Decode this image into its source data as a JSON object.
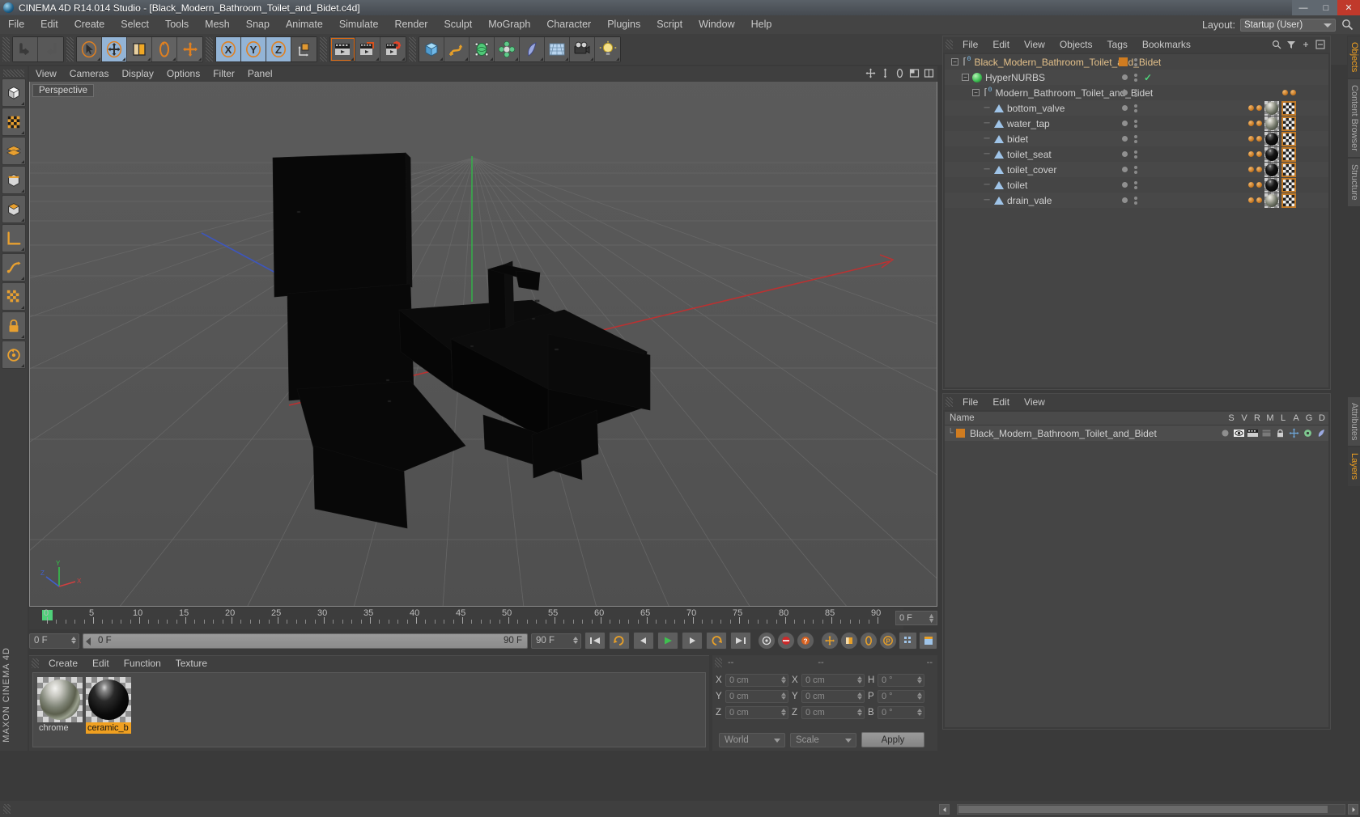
{
  "window": {
    "title": "CINEMA 4D R14.014 Studio - [Black_Modern_Bathroom_Toilet_and_Bidet.c4d]",
    "minimize": "—",
    "maximize": "□",
    "close": "✕"
  },
  "menubar": {
    "items": [
      "File",
      "Edit",
      "Create",
      "Select",
      "Tools",
      "Mesh",
      "Snap",
      "Animate",
      "Simulate",
      "Render",
      "Sculpt",
      "MoGraph",
      "Character",
      "Plugins",
      "Script",
      "Window",
      "Help"
    ],
    "layout_label": "Layout:",
    "layout_value": "Startup (User)",
    "search_icon": "magnifier-icon"
  },
  "toolbar": {
    "groups": [
      {
        "name": "history",
        "buttons": [
          {
            "name": "undo-button",
            "icon": "undo-arrow-icon",
            "state": "normal"
          },
          {
            "name": "redo-button",
            "icon": "redo-arrow-icon",
            "state": "disabled"
          }
        ]
      },
      {
        "name": "transform",
        "buttons": [
          {
            "name": "live-selection-button",
            "icon": "cursor-icon",
            "state": "normal"
          },
          {
            "name": "move-tool-button",
            "icon": "move-cross-icon",
            "state": "active"
          },
          {
            "name": "scale-tool-button",
            "icon": "scale-box-icon",
            "state": "normal"
          },
          {
            "name": "rotate-tool-button",
            "icon": "rotate-circle-icon",
            "state": "normal"
          },
          {
            "name": "combined-tool-button",
            "icon": "plus-cross-icon",
            "state": "normal"
          }
        ]
      },
      {
        "name": "axis-locks",
        "buttons": [
          {
            "name": "lock-x-axis-button",
            "icon": "x-axis-icon",
            "state": "active"
          },
          {
            "name": "lock-y-axis-button",
            "icon": "y-axis-icon",
            "state": "active"
          },
          {
            "name": "lock-z-axis-button",
            "icon": "z-axis-icon",
            "state": "active"
          },
          {
            "name": "world-object-coord-button",
            "icon": "world-cube-icon",
            "state": "normal"
          }
        ]
      },
      {
        "name": "render",
        "buttons": [
          {
            "name": "render-view-button",
            "icon": "render-clapper-icon",
            "state": "selected"
          },
          {
            "name": "render-to-picture-viewer-button",
            "icon": "render-picture-icon",
            "state": "normal"
          },
          {
            "name": "render-settings-button",
            "icon": "render-gear-icon",
            "state": "normal"
          }
        ]
      },
      {
        "name": "objects",
        "buttons": [
          {
            "name": "add-cube-button",
            "icon": "cube-icon",
            "state": "normal"
          },
          {
            "name": "add-spline-button",
            "icon": "spline-icon",
            "state": "normal"
          },
          {
            "name": "add-nurbs-button",
            "icon": "nurbs-icon",
            "state": "normal"
          },
          {
            "name": "add-array-button",
            "icon": "array-icon",
            "state": "normal"
          },
          {
            "name": "add-deformer-button",
            "icon": "bend-deformer-icon",
            "state": "normal"
          },
          {
            "name": "add-environment-button",
            "icon": "floor-environment-icon",
            "state": "normal"
          },
          {
            "name": "add-camera-button",
            "icon": "camera-icon",
            "state": "normal"
          },
          {
            "name": "add-light-button",
            "icon": "light-bulb-icon",
            "state": "normal"
          }
        ]
      }
    ]
  },
  "left_palette": {
    "buttons": [
      {
        "name": "model-mode-button",
        "icon": "model-cube-icon"
      },
      {
        "name": "texture-mode-button",
        "icon": "texture-checker-icon"
      },
      {
        "name": "point-mode-button",
        "icon": "points-icon"
      },
      {
        "name": "edge-mode-button",
        "icon": "edge-icon"
      },
      {
        "name": "polygon-mode-button",
        "icon": "polygon-icon"
      },
      {
        "name": "workplane-button",
        "icon": "workplane-icon"
      },
      {
        "name": "enable-axis-button",
        "icon": "axis-modify-icon"
      },
      {
        "name": "viewport-solo-button",
        "icon": "viewport-solo-icon"
      },
      {
        "name": "lock-workplane-button",
        "icon": "lock-icon"
      },
      {
        "name": "planar-workplane-button",
        "icon": "planar-rotate-icon"
      }
    ],
    "branding": "MAXON CINEMA 4D"
  },
  "viewport": {
    "menu": [
      "View",
      "Cameras",
      "Display",
      "Options",
      "Filter",
      "Panel"
    ],
    "label": "Perspective",
    "corner_icons": [
      "pan-icon",
      "dolly-icon",
      "rotate-icon",
      "maximize-icon",
      "layout-icon"
    ],
    "axis_gizmo": {
      "x": "X",
      "y": "Y",
      "z": "Z"
    },
    "axis_colors": {
      "x": "#d04040",
      "y": "#40c040",
      "z": "#4060d0"
    }
  },
  "timeline": {
    "ruler_labels": [
      "0",
      "5",
      "10",
      "15",
      "20",
      "25",
      "30",
      "35",
      "40",
      "45",
      "50",
      "55",
      "60",
      "65",
      "70",
      "75",
      "80",
      "85",
      "90"
    ],
    "current_frame_box": "0 F",
    "start_frame": "0 F",
    "end_display": "90 F",
    "end_frame_box": "90 F",
    "playhead_frame": "0 F"
  },
  "transport": {
    "buttons": [
      {
        "name": "go-to-start-button",
        "icon": "skip-start-icon"
      },
      {
        "name": "play-back-loop-button",
        "icon": "loop-back-icon"
      },
      {
        "name": "step-back-button",
        "icon": "step-back-icon"
      },
      {
        "name": "play-button",
        "icon": "play-icon"
      },
      {
        "name": "step-forward-button",
        "icon": "step-forward-icon"
      },
      {
        "name": "play-forward-loop-button",
        "icon": "loop-forward-icon"
      },
      {
        "name": "go-to-end-button",
        "icon": "skip-end-icon"
      }
    ],
    "record_group": [
      {
        "name": "record-active-objects-button",
        "icon": "record-circle-icon"
      },
      {
        "name": "autokeying-button",
        "icon": "autokey-icon"
      },
      {
        "name": "keyframe-selection-button",
        "icon": "question-icon"
      }
    ],
    "toggle_group": [
      {
        "name": "position-keys-button",
        "icon": "position-cross-icon"
      },
      {
        "name": "scale-keys-button",
        "icon": "scale-keys-icon"
      },
      {
        "name": "rotation-keys-button",
        "icon": "rotation-keys-icon"
      },
      {
        "name": "pla-keys-button",
        "icon": "pla-p-icon"
      },
      {
        "name": "parameter-keys-button",
        "icon": "parameter-dots-icon"
      },
      {
        "name": "animation-layers-button",
        "icon": "animation-layer-icon"
      }
    ]
  },
  "material_manager": {
    "menu": [
      "Create",
      "Edit",
      "Function",
      "Texture"
    ],
    "materials": [
      {
        "name": "chrome",
        "selected": false,
        "swatch": "chrome"
      },
      {
        "name": "ceramic_b",
        "selected": true,
        "swatch": "ceramic"
      }
    ]
  },
  "coordinates": {
    "header_dashes": [
      "--",
      "--",
      "--"
    ],
    "rows": [
      {
        "pos_label": "X",
        "pos_value": "0 cm",
        "size_label": "X",
        "size_value": "0 cm",
        "rot_label": "H",
        "rot_value": "0 °"
      },
      {
        "pos_label": "Y",
        "pos_value": "0 cm",
        "size_label": "Y",
        "size_value": "0 cm",
        "rot_label": "P",
        "rot_value": "0 °"
      },
      {
        "pos_label": "Z",
        "pos_value": "0 cm",
        "size_label": "Z",
        "size_value": "0 cm",
        "rot_label": "B",
        "rot_value": "0 °"
      }
    ],
    "coord_system": "World",
    "size_mode": "Scale",
    "apply_label": "Apply"
  },
  "object_manager": {
    "menu": [
      "File",
      "Edit",
      "View",
      "Objects",
      "Tags",
      "Bookmarks"
    ],
    "header_icons": [
      "search-icon",
      "filter-icon",
      "expand-icon",
      "collapse-icon"
    ],
    "tree": [
      {
        "name": "Black_Modern_Bathroom_Toilet_and_Bidet",
        "depth": 0,
        "icon": "null-object-icon",
        "expander": true,
        "dot": "orange-square",
        "check": false,
        "tags": [],
        "highlight": true
      },
      {
        "name": "HyperNURBS",
        "depth": 1,
        "icon": "hypernurbs-icon",
        "expander": true,
        "dot": "grey-dot",
        "check": true,
        "tags": [],
        "highlight": false
      },
      {
        "name": "Modern_Bathroom_Toilet_and_Bidet",
        "depth": 2,
        "icon": "null-object-icon",
        "expander": true,
        "dot": "grey-dot",
        "check": false,
        "tags": [
          "ball",
          "ball"
        ],
        "highlight": false
      },
      {
        "name": "bottom_valve",
        "depth": 3,
        "icon": "polygon-object-icon",
        "expander": false,
        "dot": "grey-dot",
        "check": false,
        "tags": [
          "ball",
          "ball",
          "chrome-mat",
          "uv-tag"
        ],
        "highlight": false
      },
      {
        "name": "water_tap",
        "depth": 3,
        "icon": "polygon-object-icon",
        "expander": false,
        "dot": "grey-dot",
        "check": false,
        "tags": [
          "ball",
          "ball",
          "chrome-mat",
          "uv-tag"
        ],
        "highlight": false
      },
      {
        "name": "bidet",
        "depth": 3,
        "icon": "polygon-object-icon",
        "expander": false,
        "dot": "grey-dot",
        "check": false,
        "tags": [
          "ball",
          "ball",
          "ceramic-mat",
          "uv-tag"
        ],
        "highlight": false
      },
      {
        "name": "toilet_seat",
        "depth": 3,
        "icon": "polygon-object-icon",
        "expander": false,
        "dot": "grey-dot",
        "check": false,
        "tags": [
          "ball",
          "ball",
          "ceramic-mat",
          "uv-tag"
        ],
        "highlight": false
      },
      {
        "name": "toilet_cover",
        "depth": 3,
        "icon": "polygon-object-icon",
        "expander": false,
        "dot": "grey-dot",
        "check": false,
        "tags": [
          "ball",
          "ball",
          "ceramic-mat",
          "uv-tag"
        ],
        "highlight": false
      },
      {
        "name": "toilet",
        "depth": 3,
        "icon": "polygon-object-icon",
        "expander": false,
        "dot": "grey-dot",
        "check": false,
        "tags": [
          "ball",
          "ball",
          "ceramic-mat",
          "uv-tag"
        ],
        "highlight": false
      },
      {
        "name": "drain_vale",
        "depth": 3,
        "icon": "polygon-object-icon",
        "expander": false,
        "dot": "grey-dot",
        "check": false,
        "tags": [
          "ball",
          "ball",
          "chrome-mat",
          "uv-tag"
        ],
        "highlight": false
      }
    ]
  },
  "layer_manager": {
    "menu": [
      "File",
      "Edit",
      "View"
    ],
    "columns": [
      "Name",
      "S",
      "V",
      "R",
      "M",
      "L",
      "A",
      "G",
      "D"
    ],
    "rows": [
      {
        "name": "Black_Modern_Bathroom_Toilet_and_Bidet",
        "color": "#d07c20"
      }
    ]
  },
  "vertical_tabs_top": [
    {
      "label": "Objects",
      "active": true
    },
    {
      "label": "Content Browser",
      "active": false
    },
    {
      "label": "Structure",
      "active": false
    }
  ],
  "vertical_tabs_bottom": [
    {
      "label": "Attributes",
      "active": false
    },
    {
      "label": "Layers",
      "active": true
    }
  ],
  "colors": {
    "accent_orange": "#f0a020",
    "tag_orange": "#d07c20",
    "active_blue": "#93b4d6",
    "green_check": "#4fd17a",
    "panel_bg": "#3f3f3f",
    "viewport_bg": "#555555"
  }
}
